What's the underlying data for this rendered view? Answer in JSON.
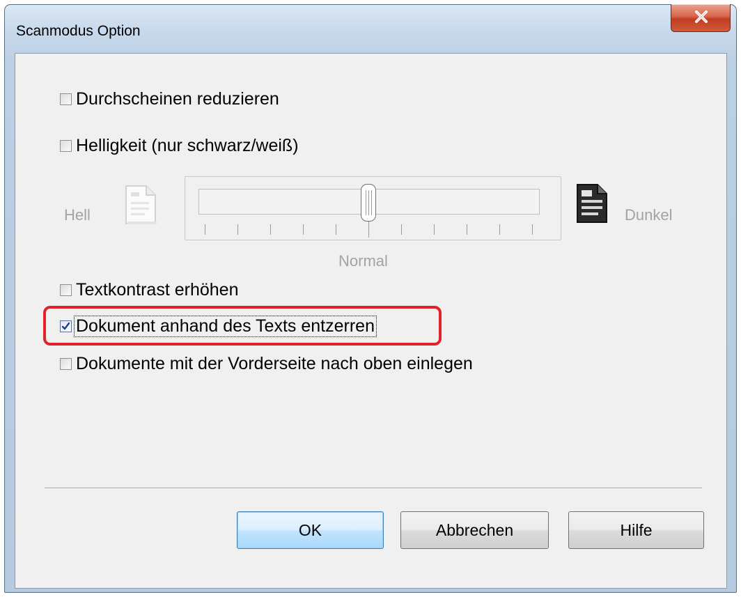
{
  "window": {
    "title": "Scanmodus Option",
    "close_label": "X"
  },
  "options": {
    "reduce_bleed": {
      "label": "Durchscheinen reduzieren",
      "checked": false
    },
    "brightness": {
      "label": "Helligkeit (nur schwarz/weiß)",
      "checked": false
    },
    "text_contrast": {
      "label": "Textkontrast erhöhen",
      "checked": false
    },
    "deskew": {
      "label": "Dokument anhand des Texts entzerren",
      "checked": true
    },
    "face_up": {
      "label": "Dokumente mit der Vorderseite nach oben einlegen",
      "checked": false
    }
  },
  "brightness_slider": {
    "left_label": "Hell",
    "right_label": "Dunkel",
    "center_label": "Normal",
    "value": 5,
    "min": 0,
    "max": 10,
    "enabled": false
  },
  "buttons": {
    "ok": "OK",
    "cancel": "Abbrechen",
    "help": "Hilfe"
  },
  "colors": {
    "highlight": "#e0232a",
    "default_button": "#a9d9fc"
  }
}
